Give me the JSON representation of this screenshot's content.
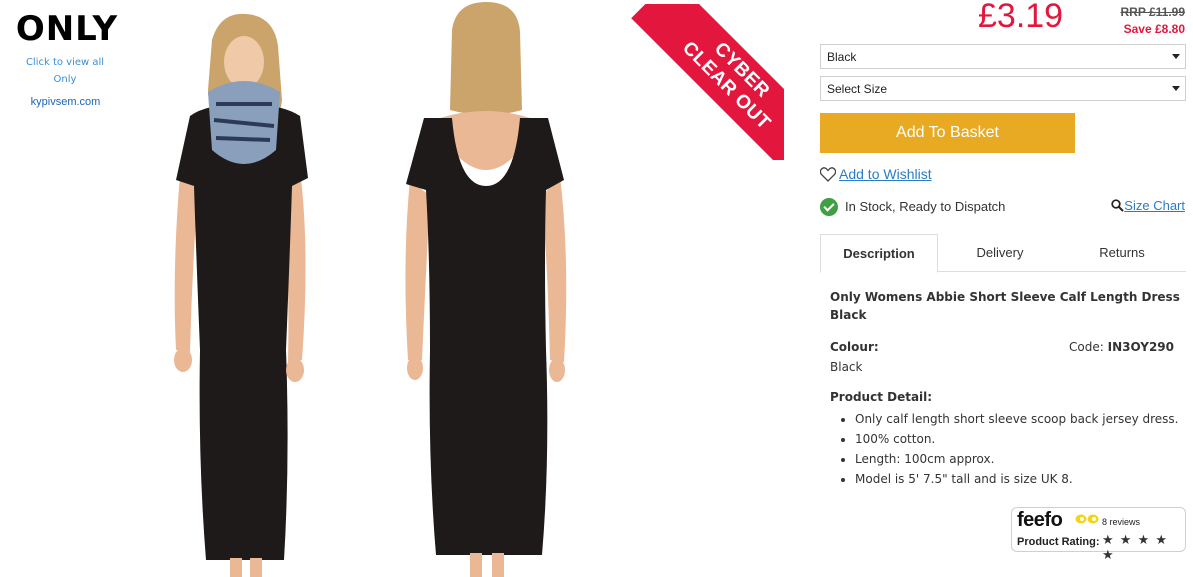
{
  "brand": {
    "logo_text": "ONLY",
    "view_all_line1": "Click to view all",
    "view_all_line2": "Only",
    "watermark": "kypivsem.com"
  },
  "promo": {
    "ribbon_line1": "CYBER",
    "ribbon_line2": "CLEAR OUT"
  },
  "pricing": {
    "price": "£3.19",
    "rrp": "RRP £11.99",
    "save": "Save £8.80",
    "accent_color": "#e3173d"
  },
  "options": {
    "colour_selected": "Black",
    "size_placeholder": "Select Size"
  },
  "actions": {
    "add_to_basket": "Add To Basket",
    "basket_color": "#e9aa23",
    "wishlist": "Add to Wishlist",
    "size_chart": "Size Chart"
  },
  "stock": {
    "status": "In Stock, Ready to Dispatch"
  },
  "tabs": [
    {
      "label": "Description",
      "active": true
    },
    {
      "label": "Delivery",
      "active": false
    },
    {
      "label": "Returns",
      "active": false
    }
  ],
  "description": {
    "title": "Only Womens Abbie Short Sleeve Calf Length Dress Black",
    "colour_label": "Colour:",
    "colour_value": "Black",
    "code_label": "Code:",
    "code_value": "IN3OY290",
    "detail_label": "Product Detail:",
    "details": [
      "Only calf length short sleeve scoop back jersey dress.",
      "100% cotton.",
      "Length: 100cm approx.",
      "Model is 5' 7.5\" tall and is size UK 8."
    ]
  },
  "feefo": {
    "logo": "feefo",
    "reviews": "8 reviews",
    "rating_label": "Product Rating:",
    "stars": "★ ★ ★ ★ ★"
  }
}
